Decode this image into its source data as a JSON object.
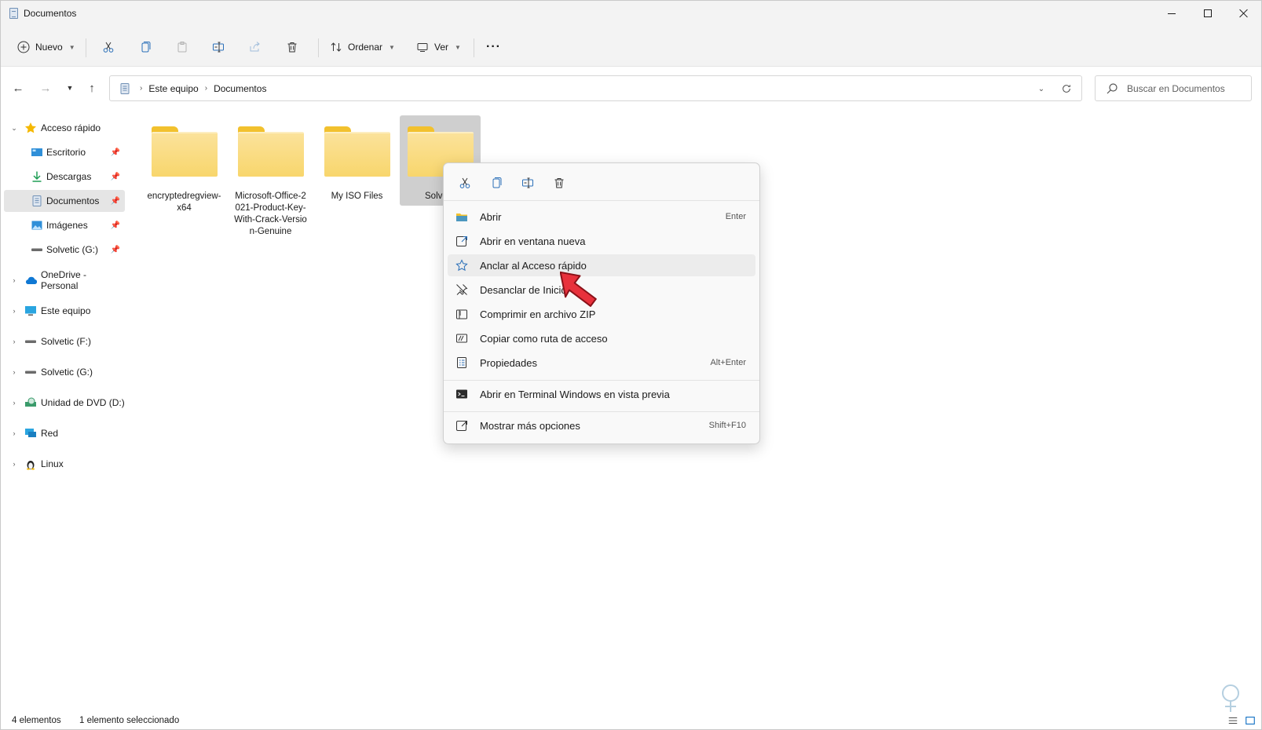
{
  "window": {
    "title": "Documentos"
  },
  "commandbar": {
    "new_label": "Nuevo",
    "sort_label": "Ordenar",
    "view_label": "Ver",
    "more_label": "···"
  },
  "address": {
    "crumbs": [
      "Este equipo",
      "Documentos"
    ]
  },
  "search": {
    "placeholder": "Buscar en Documentos"
  },
  "sidebar": {
    "items": [
      {
        "label": "Acceso rápido",
        "icon": "star-icon"
      },
      {
        "label": "Escritorio",
        "icon": "desktop-icon"
      },
      {
        "label": "Descargas",
        "icon": "download-icon"
      },
      {
        "label": "Documentos",
        "icon": "document-icon"
      },
      {
        "label": "Imágenes",
        "icon": "pictures-icon"
      },
      {
        "label": "Solvetic (G:)",
        "icon": "drive-icon"
      },
      {
        "label": "OneDrive - Personal",
        "icon": "cloud-icon"
      },
      {
        "label": "Este equipo",
        "icon": "computer-icon"
      },
      {
        "label": "Solvetic (F:)",
        "icon": "drive-icon"
      },
      {
        "label": "Solvetic (G:)",
        "icon": "drive-icon"
      },
      {
        "label": "Unidad de DVD (D:)",
        "icon": "dvd-icon"
      },
      {
        "label": "Red",
        "icon": "network-icon"
      },
      {
        "label": "Linux",
        "icon": "linux-icon"
      }
    ]
  },
  "files": [
    {
      "name": "encryptedregview-x64"
    },
    {
      "name": "Microsoft-Office-2021-Product-Key-With-Crack-Version-Genuine"
    },
    {
      "name": "My ISO Files"
    },
    {
      "name": "Solve"
    }
  ],
  "context_menu": {
    "items": [
      {
        "label": "Abrir",
        "shortcut": "Enter",
        "icon": "folder-open-icon"
      },
      {
        "label": "Abrir en ventana nueva",
        "shortcut": "",
        "icon": "open-new-window-icon"
      },
      {
        "label": "Anclar al Acceso rápido",
        "shortcut": "",
        "icon": "star-outline-icon"
      },
      {
        "label": "Desanclar de Inicio",
        "shortcut": "",
        "icon": "unpin-icon"
      },
      {
        "label": "Comprimir en archivo ZIP",
        "shortcut": "",
        "icon": "zip-icon"
      },
      {
        "label": "Copiar como ruta de acceso",
        "shortcut": "",
        "icon": "copy-path-icon"
      },
      {
        "label": "Propiedades",
        "shortcut": "Alt+Enter",
        "icon": "properties-icon"
      },
      {
        "label": "Abrir en Terminal Windows en vista previa",
        "shortcut": "",
        "icon": "terminal-icon"
      },
      {
        "label": "Mostrar más opciones",
        "shortcut": "Shift+F10",
        "icon": "more-options-icon"
      }
    ]
  },
  "status": {
    "count": "4 elementos",
    "selection": "1 elemento seleccionado"
  },
  "colors": {
    "folder": "#f8d66c",
    "accent": "#0067c0",
    "pointer": "#e8313c"
  }
}
